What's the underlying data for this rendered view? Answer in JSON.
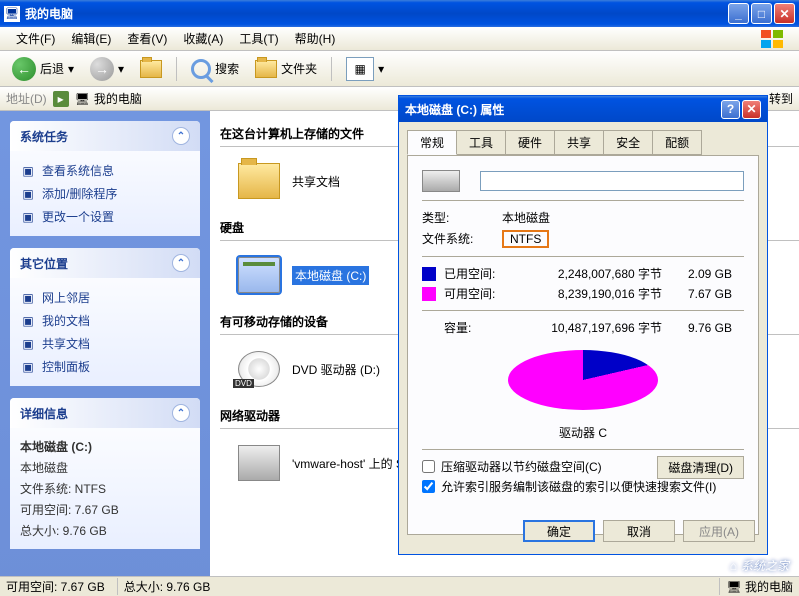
{
  "window": {
    "title": "我的电脑"
  },
  "menubar": [
    "文件(F)",
    "编辑(E)",
    "查看(V)",
    "收藏(A)",
    "工具(T)",
    "帮助(H)"
  ],
  "toolbar": {
    "back": "后退",
    "search": "搜索",
    "folders": "文件夹"
  },
  "addressbar": {
    "label": "地址(D)",
    "location": "我的电脑",
    "extra": "转到"
  },
  "sidebar": {
    "panels": [
      {
        "title": "系统任务",
        "links": [
          "查看系统信息",
          "添加/删除程序",
          "更改一个设置"
        ]
      },
      {
        "title": "其它位置",
        "links": [
          "网上邻居",
          "我的文档",
          "共享文档",
          "控制面板"
        ]
      },
      {
        "title": "详细信息",
        "details": {
          "name": "本地磁盘 (C:)",
          "type": "本地磁盘",
          "fs_label": "文件系统: NTFS",
          "free_label": "可用空间: 7.67 GB",
          "total_label": "总大小: 9.76 GB"
        }
      }
    ]
  },
  "content": {
    "sections": [
      {
        "header": "在这台计算机上存储的文件",
        "items": [
          {
            "label": "共享文档",
            "icon": "folder"
          }
        ]
      },
      {
        "header": "硬盘",
        "items": [
          {
            "label": "本地磁盘 (C:)",
            "icon": "hdd",
            "selected": true
          }
        ]
      },
      {
        "header": "有可移动存储的设备",
        "items": [
          {
            "label": "DVD 驱动器 (D:)",
            "icon": "dvd"
          }
        ]
      },
      {
        "header": "网络驱动器",
        "items": [
          {
            "label": "'vmware-host' 上的 Shared Folders (Z:)",
            "icon": "netdrive"
          }
        ]
      }
    ]
  },
  "dialog": {
    "title": "本地磁盘 (C:) 属性",
    "tabs": [
      "常规",
      "工具",
      "硬件",
      "共享",
      "安全",
      "配额"
    ],
    "type_label": "类型:",
    "type_value": "本地磁盘",
    "fs_label": "文件系统:",
    "fs_value": "NTFS",
    "used_label": "已用空间:",
    "used_bytes": "2,248,007,680 字节",
    "used_gb": "2.09 GB",
    "free_label": "可用空间:",
    "free_bytes": "8,239,190,016 字节",
    "free_gb": "7.67 GB",
    "cap_label": "容量:",
    "cap_bytes": "10,487,197,696 字节",
    "cap_gb": "9.76 GB",
    "pie_label": "驱动器 C",
    "disk_cleanup": "磁盘清理(D)",
    "check1": "压缩驱动器以节约磁盘空间(C)",
    "check2": "允许索引服务编制该磁盘的索引以便快速搜索文件(I)",
    "ok": "确定",
    "cancel": "取消",
    "apply": "应用(A)"
  },
  "chart_data": {
    "type": "pie",
    "title": "驱动器 C",
    "series": [
      {
        "name": "已用空间",
        "value": 2248007680,
        "value_gb": 2.09,
        "color": "#0000c8"
      },
      {
        "name": "可用空间",
        "value": 8239190016,
        "value_gb": 7.67,
        "color": "#ff00ff"
      }
    ],
    "total": 10487197696,
    "total_gb": 9.76
  },
  "statusbar": {
    "free": "可用空间: 7.67 GB",
    "total": "总大小: 9.76 GB",
    "loc": "我的电脑"
  },
  "watermark": "系统之家"
}
